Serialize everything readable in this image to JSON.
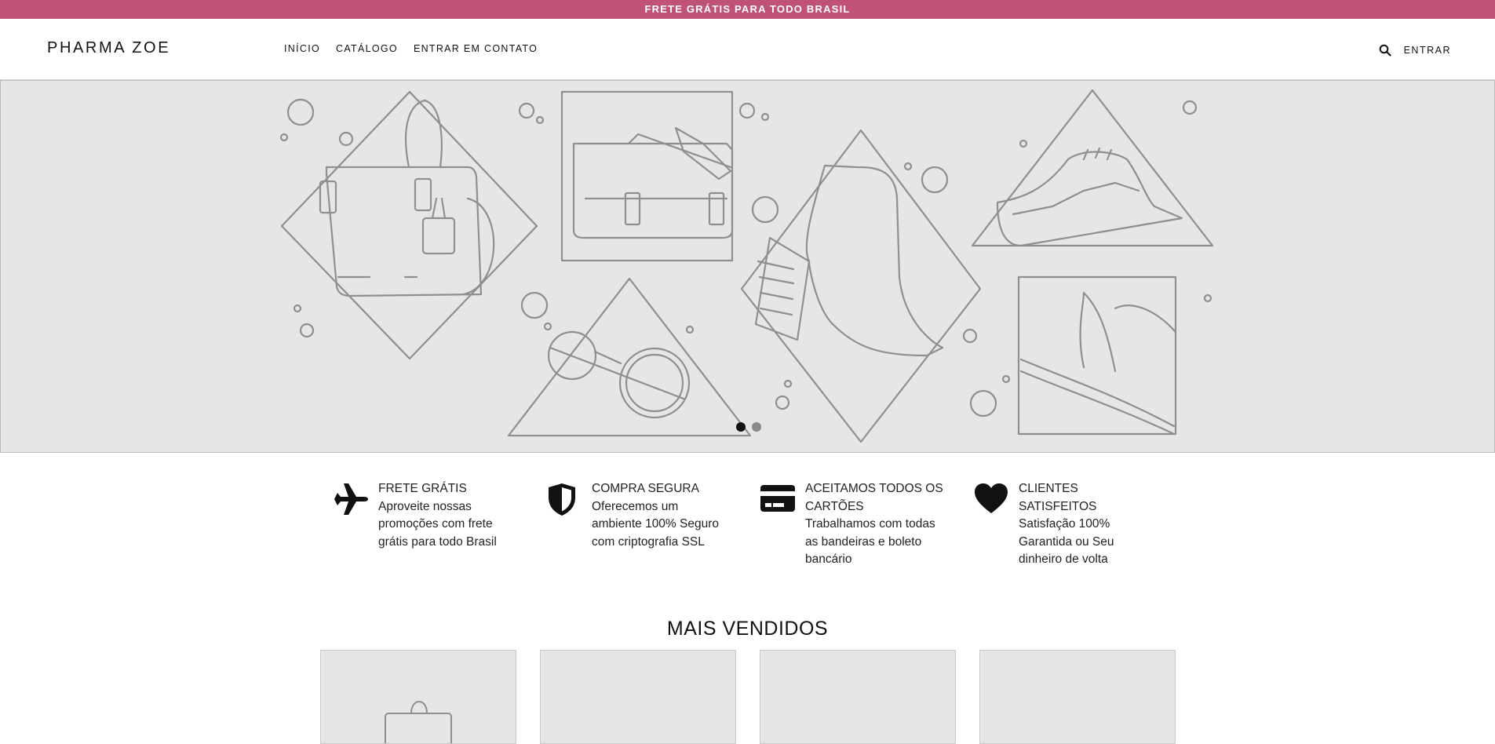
{
  "announcement": "FRETE GRÁTIS PARA TODO BRASIL",
  "brand": "PHARMA ZOE",
  "nav": [
    {
      "label": "INÍCIO"
    },
    {
      "label": "CATÁLOGO"
    },
    {
      "label": "ENTRAR EM CONTATO"
    }
  ],
  "header": {
    "login_label": "ENTRAR",
    "search_icon": "search-icon"
  },
  "hero": {
    "slides": 2,
    "active_slide": 1
  },
  "features": [
    {
      "icon": "airplane-icon",
      "title": "FRETE GRÁTIS",
      "text": "Aproveite nossas promoções com frete grátis para todo Brasil"
    },
    {
      "icon": "shield-icon",
      "title": "COMPRA SEGURA",
      "text": "Oferecemos um ambiente 100% Seguro com criptografia SSL"
    },
    {
      "icon": "credit-card-icon",
      "title": "ACEITAMOS TODOS OS CARTÕES",
      "text": "Trabalhamos com todas as bandeiras e boleto bancário"
    },
    {
      "icon": "heart-icon",
      "title": "CLIENTES SATISFEITOS",
      "text": "Satisfação 100% Garantida ou Seu dinheiro de volta"
    }
  ],
  "best_sellers_title": "MAIS VENDIDOS",
  "colors": {
    "announcement_bg": "#c05277",
    "placeholder_bg": "#e6e6e6",
    "line_art": "#8f8f8f"
  }
}
